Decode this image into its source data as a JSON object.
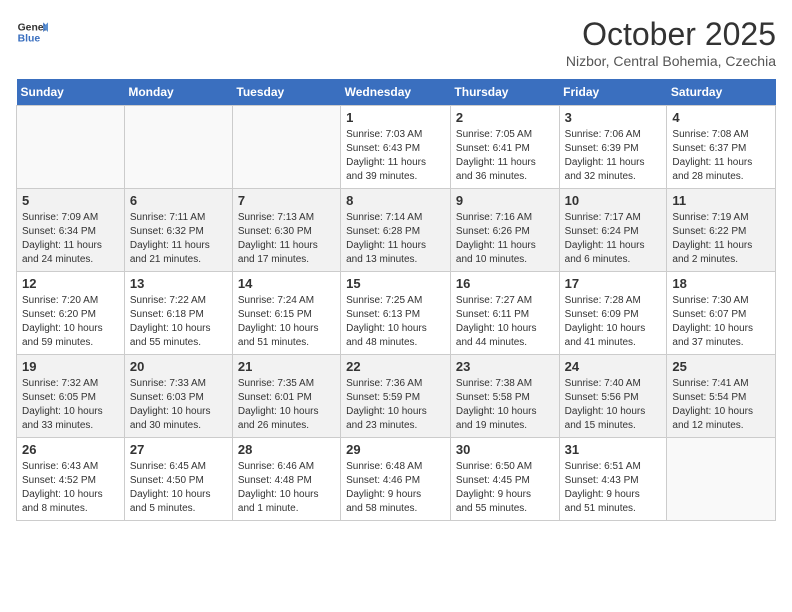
{
  "logo": {
    "line1": "General",
    "line2": "Blue"
  },
  "header": {
    "month": "October 2025",
    "location": "Nizbor, Central Bohemia, Czechia"
  },
  "weekdays": [
    "Sunday",
    "Monday",
    "Tuesday",
    "Wednesday",
    "Thursday",
    "Friday",
    "Saturday"
  ],
  "weeks": [
    [
      {
        "day": "",
        "info": ""
      },
      {
        "day": "",
        "info": ""
      },
      {
        "day": "",
        "info": ""
      },
      {
        "day": "1",
        "info": "Sunrise: 7:03 AM\nSunset: 6:43 PM\nDaylight: 11 hours\nand 39 minutes."
      },
      {
        "day": "2",
        "info": "Sunrise: 7:05 AM\nSunset: 6:41 PM\nDaylight: 11 hours\nand 36 minutes."
      },
      {
        "day": "3",
        "info": "Sunrise: 7:06 AM\nSunset: 6:39 PM\nDaylight: 11 hours\nand 32 minutes."
      },
      {
        "day": "4",
        "info": "Sunrise: 7:08 AM\nSunset: 6:37 PM\nDaylight: 11 hours\nand 28 minutes."
      }
    ],
    [
      {
        "day": "5",
        "info": "Sunrise: 7:09 AM\nSunset: 6:34 PM\nDaylight: 11 hours\nand 24 minutes."
      },
      {
        "day": "6",
        "info": "Sunrise: 7:11 AM\nSunset: 6:32 PM\nDaylight: 11 hours\nand 21 minutes."
      },
      {
        "day": "7",
        "info": "Sunrise: 7:13 AM\nSunset: 6:30 PM\nDaylight: 11 hours\nand 17 minutes."
      },
      {
        "day": "8",
        "info": "Sunrise: 7:14 AM\nSunset: 6:28 PM\nDaylight: 11 hours\nand 13 minutes."
      },
      {
        "day": "9",
        "info": "Sunrise: 7:16 AM\nSunset: 6:26 PM\nDaylight: 11 hours\nand 10 minutes."
      },
      {
        "day": "10",
        "info": "Sunrise: 7:17 AM\nSunset: 6:24 PM\nDaylight: 11 hours\nand 6 minutes."
      },
      {
        "day": "11",
        "info": "Sunrise: 7:19 AM\nSunset: 6:22 PM\nDaylight: 11 hours\nand 2 minutes."
      }
    ],
    [
      {
        "day": "12",
        "info": "Sunrise: 7:20 AM\nSunset: 6:20 PM\nDaylight: 10 hours\nand 59 minutes."
      },
      {
        "day": "13",
        "info": "Sunrise: 7:22 AM\nSunset: 6:18 PM\nDaylight: 10 hours\nand 55 minutes."
      },
      {
        "day": "14",
        "info": "Sunrise: 7:24 AM\nSunset: 6:15 PM\nDaylight: 10 hours\nand 51 minutes."
      },
      {
        "day": "15",
        "info": "Sunrise: 7:25 AM\nSunset: 6:13 PM\nDaylight: 10 hours\nand 48 minutes."
      },
      {
        "day": "16",
        "info": "Sunrise: 7:27 AM\nSunset: 6:11 PM\nDaylight: 10 hours\nand 44 minutes."
      },
      {
        "day": "17",
        "info": "Sunrise: 7:28 AM\nSunset: 6:09 PM\nDaylight: 10 hours\nand 41 minutes."
      },
      {
        "day": "18",
        "info": "Sunrise: 7:30 AM\nSunset: 6:07 PM\nDaylight: 10 hours\nand 37 minutes."
      }
    ],
    [
      {
        "day": "19",
        "info": "Sunrise: 7:32 AM\nSunset: 6:05 PM\nDaylight: 10 hours\nand 33 minutes."
      },
      {
        "day": "20",
        "info": "Sunrise: 7:33 AM\nSunset: 6:03 PM\nDaylight: 10 hours\nand 30 minutes."
      },
      {
        "day": "21",
        "info": "Sunrise: 7:35 AM\nSunset: 6:01 PM\nDaylight: 10 hours\nand 26 minutes."
      },
      {
        "day": "22",
        "info": "Sunrise: 7:36 AM\nSunset: 5:59 PM\nDaylight: 10 hours\nand 23 minutes."
      },
      {
        "day": "23",
        "info": "Sunrise: 7:38 AM\nSunset: 5:58 PM\nDaylight: 10 hours\nand 19 minutes."
      },
      {
        "day": "24",
        "info": "Sunrise: 7:40 AM\nSunset: 5:56 PM\nDaylight: 10 hours\nand 15 minutes."
      },
      {
        "day": "25",
        "info": "Sunrise: 7:41 AM\nSunset: 5:54 PM\nDaylight: 10 hours\nand 12 minutes."
      }
    ],
    [
      {
        "day": "26",
        "info": "Sunrise: 6:43 AM\nSunset: 4:52 PM\nDaylight: 10 hours\nand 8 minutes."
      },
      {
        "day": "27",
        "info": "Sunrise: 6:45 AM\nSunset: 4:50 PM\nDaylight: 10 hours\nand 5 minutes."
      },
      {
        "day": "28",
        "info": "Sunrise: 6:46 AM\nSunset: 4:48 PM\nDaylight: 10 hours\nand 1 minute."
      },
      {
        "day": "29",
        "info": "Sunrise: 6:48 AM\nSunset: 4:46 PM\nDaylight: 9 hours\nand 58 minutes."
      },
      {
        "day": "30",
        "info": "Sunrise: 6:50 AM\nSunset: 4:45 PM\nDaylight: 9 hours\nand 55 minutes."
      },
      {
        "day": "31",
        "info": "Sunrise: 6:51 AM\nSunset: 4:43 PM\nDaylight: 9 hours\nand 51 minutes."
      },
      {
        "day": "",
        "info": ""
      }
    ]
  ]
}
